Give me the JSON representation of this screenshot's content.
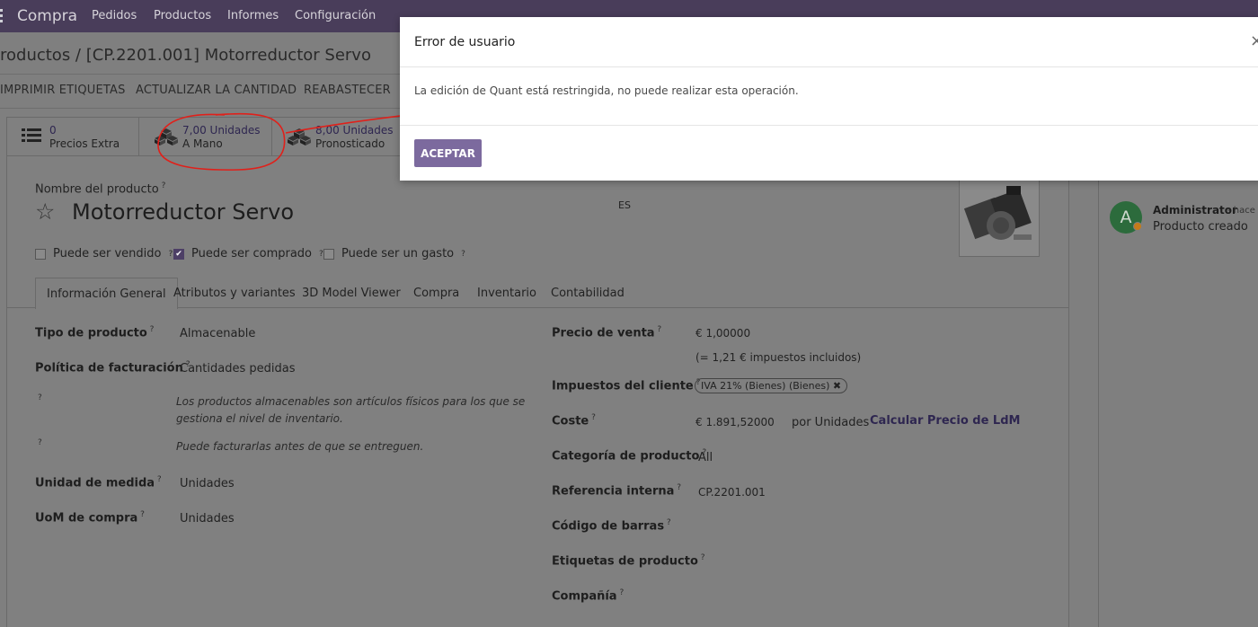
{
  "navbar": {
    "brand": "Compra",
    "menu": [
      "Pedidos",
      "Productos",
      "Informes",
      "Configuración"
    ]
  },
  "breadcrumb": "roductos / [CP.2201.001] Motorreductor Servo",
  "actions": [
    "IMPRIMIR ETIQUETAS",
    "ACTUALIZAR LA CANTIDAD",
    "REABASTECER"
  ],
  "stats": [
    {
      "value": "0",
      "label": "Precios Extra",
      "icon": "list-icon"
    },
    {
      "value": "7,00 Unidades",
      "label": "A Mano",
      "icon": "cubes-icon"
    },
    {
      "value": "8,00 Unidades",
      "label": "Pronosticado",
      "icon": "cubes-icon"
    }
  ],
  "product": {
    "name_label": "Nombre del producto",
    "name": "Motorreductor Servo",
    "lang": "ES",
    "checkboxes": [
      {
        "label": "Puede ser vendido",
        "checked": false
      },
      {
        "label": "Puede ser comprado",
        "checked": true
      },
      {
        "label": "Puede ser un gasto",
        "checked": false
      }
    ]
  },
  "tabs": [
    "Información General",
    "Atributos y variantes",
    "3D Model Viewer",
    "Compra",
    "Inventario",
    "Contabilidad"
  ],
  "left_fields": {
    "tipo_label": "Tipo de producto",
    "tipo_value": "Almacenable",
    "politica_label": "Política de facturación",
    "politica_value": "Cantidades pedidas",
    "help1": "Los productos almacenables son artículos físicos para los que se gestiona el nivel de inventario.",
    "help2": "Puede facturarlas antes de que se entreguen.",
    "unidad_label": "Unidad de medida",
    "unidad_value": "Unidades",
    "uom_label": "UoM de compra",
    "uom_value": "Unidades"
  },
  "right_fields": {
    "precio_label": "Precio de venta",
    "precio_value": "€ 1,00000",
    "precio_tax": "(= 1,21 € impuestos incluidos)",
    "impuestos_label": "Impuestos del cliente",
    "impuestos_tag": "IVA 21% (Bienes) (Bienes)",
    "coste_label": "Coste",
    "coste_value": "€ 1.891,52000",
    "coste_unit": "por Unidades",
    "coste_link": "Calcular Precio de LdM",
    "categoria_label": "Categoría de producto",
    "categoria_value": "All",
    "ref_label": "Referencia interna",
    "ref_value": "CP.2201.001",
    "barras_label": "Código de barras",
    "etiquetas_label": "Etiquetas de producto",
    "compania_label": "Compañía"
  },
  "chatter": {
    "avatar": "A",
    "author": "Administrator",
    "when": "- hace",
    "message": "Producto creado"
  },
  "modal": {
    "title": "Error de usuario",
    "message": "La edición de Quant está restringida, no puede realizar esta operación.",
    "button": "ACEPTAR"
  },
  "colors": {
    "navbar": "#493d5a",
    "primary_button": "#7c6a9e",
    "annotation": "#e0201a"
  }
}
